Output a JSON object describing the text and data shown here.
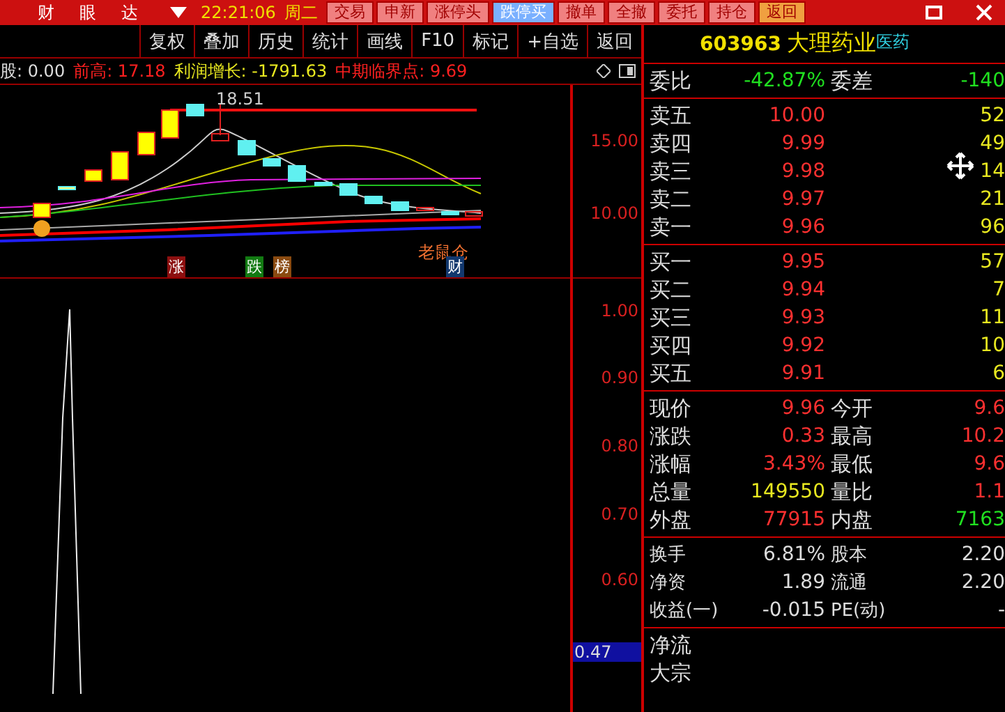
{
  "top_bar": {
    "menu": [
      "财",
      "眼",
      "达"
    ],
    "time": "22:21:06",
    "weekday": "周二",
    "buttons": [
      {
        "label": "交易",
        "kind": "plain"
      },
      {
        "label": "申新",
        "kind": "plain"
      },
      {
        "label": "涨停头",
        "kind": "plain"
      },
      {
        "label": "跌停买",
        "kind": "highlight"
      },
      {
        "label": "撤单",
        "kind": "plain"
      },
      {
        "label": "全撤",
        "kind": "plain"
      },
      {
        "label": "委托",
        "kind": "plain"
      },
      {
        "label": "持仓",
        "kind": "plain"
      },
      {
        "label": "返回",
        "kind": "back"
      }
    ]
  },
  "toolbar": [
    "复权",
    "叠加",
    "历史",
    "统计",
    "画线",
    "F10",
    "标记",
    "+自选",
    "返回"
  ],
  "indicator_line": {
    "prefix": "股: 0.00",
    "items": [
      {
        "label": "前高: 17.18",
        "kind": "alert"
      },
      {
        "label": "利润增长: -1791.63",
        "kind": "note"
      },
      {
        "label": "中期临界点: 9.69",
        "kind": "alert"
      }
    ]
  },
  "main_chart": {
    "peak_label": "18.51",
    "signal_label": "老鼠仓",
    "axis": [
      "15.00",
      "10.00"
    ],
    "badges": [
      {
        "text": "涨",
        "color": "#8c1010"
      },
      {
        "text": "跌",
        "color": "#127a12"
      },
      {
        "text": "榜",
        "color": "#8a4a10"
      },
      {
        "text": "财",
        "color": "#12386e"
      }
    ]
  },
  "sub_chart": {
    "axis": [
      "1.00",
      "0.90",
      "0.80",
      "0.70",
      "0.60"
    ],
    "current": "0.47"
  },
  "quote": {
    "code": "603963",
    "name": "大理药业",
    "sector": "医药",
    "ratio": {
      "label": "委比",
      "value": "-42.87%",
      "label2": "委差",
      "value2": "-140"
    },
    "asks": [
      {
        "label": "卖五",
        "price": "10.00",
        "volume": "52"
      },
      {
        "label": "卖四",
        "price": "9.99",
        "volume": "49"
      },
      {
        "label": "卖三",
        "price": "9.98",
        "volume": "14"
      },
      {
        "label": "卖二",
        "price": "9.97",
        "volume": "21"
      },
      {
        "label": "卖一",
        "price": "9.96",
        "volume": "96"
      }
    ],
    "bids": [
      {
        "label": "买一",
        "price": "9.95",
        "volume": "57"
      },
      {
        "label": "买二",
        "price": "9.94",
        "volume": "7"
      },
      {
        "label": "买三",
        "price": "9.93",
        "volume": "11"
      },
      {
        "label": "买四",
        "price": "9.92",
        "volume": "10"
      },
      {
        "label": "买五",
        "price": "9.91",
        "volume": "6"
      }
    ],
    "stats": [
      [
        {
          "label": "现价",
          "value": "9.96",
          "kind": "rise"
        },
        {
          "label": "今开",
          "value": "9.6",
          "kind": "rise"
        }
      ],
      [
        {
          "label": "涨跌",
          "value": "0.33",
          "kind": "rise"
        },
        {
          "label": "最高",
          "value": "10.2",
          "kind": "rise"
        }
      ],
      [
        {
          "label": "涨幅",
          "value": "3.43%",
          "kind": "rise"
        },
        {
          "label": "最低",
          "value": "9.6",
          "kind": "rise"
        }
      ],
      [
        {
          "label": "总量",
          "value": "149550",
          "kind": "volume"
        },
        {
          "label": "量比",
          "value": "1.1",
          "kind": "rise"
        }
      ],
      [
        {
          "label": "外盘",
          "value": "77915",
          "kind": "rise"
        },
        {
          "label": "内盘",
          "value": "7163",
          "kind": "fall"
        }
      ]
    ],
    "fundamentals": [
      {
        "label": "换手",
        "value": "6.81%",
        "label2": "股本",
        "value2": "2.20"
      },
      {
        "label": "净资",
        "value": "1.89",
        "label2": "流通",
        "value2": "2.20"
      },
      {
        "label": "收益(一)",
        "value": "-0.015",
        "label2": "PE(动)",
        "value2": "-"
      }
    ],
    "flows": [
      "净流",
      "大宗"
    ]
  }
}
